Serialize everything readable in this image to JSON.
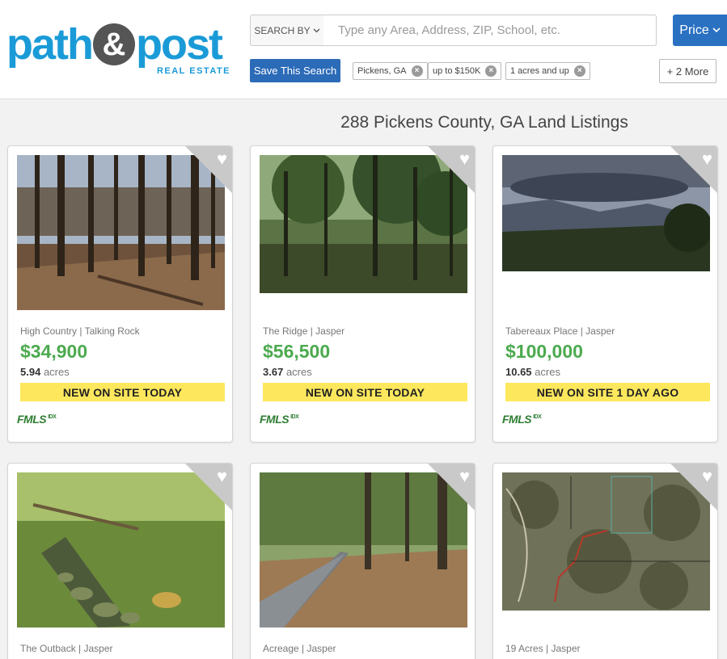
{
  "logo": {
    "word1": "path",
    "amp": "&",
    "word2": "post",
    "sub": "REAL ESTATE"
  },
  "search": {
    "by_label": "SEARCH BY",
    "placeholder": "Type any Area, Address, ZIP, School, etc."
  },
  "price_label": "Price",
  "save_label": "Save This Search",
  "filters": [
    "Pickens, GA",
    "up to $150K",
    "1 acres and up"
  ],
  "more_label": "+ 2 More",
  "listing_title": "288 Pickens County, GA Land Listings",
  "cards": [
    {
      "location": "High Country | Talking Rock",
      "price": "$34,900",
      "acres_num": "5.94",
      "acres_unit": "acres",
      "badge": "NEW ON SITE TODAY",
      "mls": "FMLS",
      "idx": "IDX",
      "heart": "♥"
    },
    {
      "location": "The Ridge | Jasper",
      "price": "$56,500",
      "acres_num": "3.67",
      "acres_unit": "acres",
      "badge": "NEW ON SITE TODAY",
      "mls": "FMLS",
      "idx": "IDX",
      "heart": "♥"
    },
    {
      "location": "Tabereaux Place | Jasper",
      "price": "$100,000",
      "acres_num": "10.65",
      "acres_unit": "acres",
      "badge": "NEW ON SITE 1 DAY AGO",
      "mls": "FMLS",
      "idx": "IDX",
      "heart": "♥"
    },
    {
      "location": "The Outback | Jasper",
      "heart": "♥"
    },
    {
      "location": "Acreage | Jasper",
      "heart": "♥"
    },
    {
      "location": "19 Acres | Jasper",
      "heart": "♥"
    }
  ],
  "colors": {
    "brand_blue": "#1a9bd7",
    "button_blue": "#2c6bb8",
    "price_green": "#4caa4f",
    "badge_yellow": "#fde85d"
  },
  "icons": [
    "chevron-down-icon",
    "close-icon",
    "heart-icon"
  ]
}
